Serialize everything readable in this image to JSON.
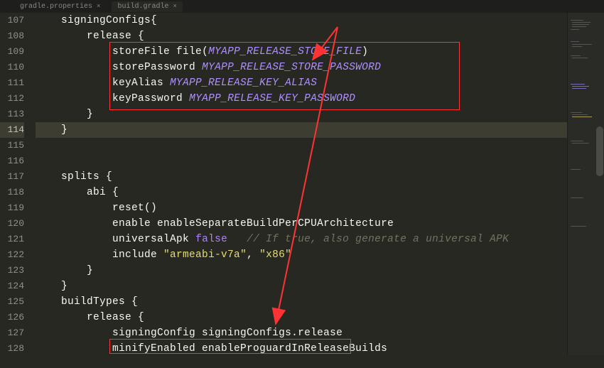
{
  "tabs": [
    {
      "label": "gradle.properties",
      "active": false
    },
    {
      "label": "build.gradle",
      "active": true
    }
  ],
  "lineNumbers": [
    "107",
    "108",
    "109",
    "110",
    "111",
    "112",
    "113",
    "114",
    "115",
    "116",
    "117",
    "118",
    "119",
    "120",
    "121",
    "122",
    "123",
    "124",
    "125",
    "126",
    "127",
    "128"
  ],
  "currentLine": "114",
  "code": {
    "l107": {
      "indent": "    ",
      "text": "signingConfigs{"
    },
    "l108": {
      "indent": "        ",
      "text": "release {"
    },
    "l109": {
      "indent": "            ",
      "a": "storeFile ",
      "b": "file",
      "c": "(",
      "d": "MYAPP_RELEASE_STORE_FILE",
      "e": ")"
    },
    "l110": {
      "indent": "            ",
      "a": "storePassword ",
      "d": "MYAPP_RELEASE_STORE_PASSWORD"
    },
    "l111": {
      "indent": "            ",
      "a": "keyAlias ",
      "d": "MYAPP_RELEASE_KEY_ALIAS"
    },
    "l112": {
      "indent": "            ",
      "a": "keyPassword ",
      "d": "MYAPP_RELEASE_KEY_PASSWORD"
    },
    "l113": {
      "indent": "        ",
      "text": "}"
    },
    "l114": {
      "indent": "    ",
      "text": "}"
    },
    "l115": {
      "text": ""
    },
    "l116": {
      "text": ""
    },
    "l117": {
      "indent": "    ",
      "text": "splits {"
    },
    "l118": {
      "indent": "        ",
      "text": "abi {"
    },
    "l119": {
      "indent": "            ",
      "a": "reset",
      "b": "()"
    },
    "l120": {
      "indent": "            ",
      "a": "enable enableSeparateBuildPerCPUArchitecture"
    },
    "l121": {
      "indent": "            ",
      "a": "universalApk ",
      "b": "false",
      "c": "   // If true, also generate a universal APK"
    },
    "l122": {
      "indent": "            ",
      "a": "include ",
      "b": "\"armeabi-v7a\"",
      "c": ", ",
      "d": "\"x86\""
    },
    "l123": {
      "indent": "        ",
      "text": "}"
    },
    "l124": {
      "indent": "    ",
      "text": "}"
    },
    "l125": {
      "indent": "    ",
      "text": "buildTypes {"
    },
    "l126": {
      "indent": "        ",
      "text": "release {"
    },
    "l127": {
      "indent": "            ",
      "a": "signingConfig signingConfigs",
      "b": ".",
      "c": "release"
    },
    "l128": {
      "indent": "            ",
      "a": "minifyEnabled enableProguardInReleaseBuilds"
    }
  },
  "colors": {
    "accent": "#ff3333",
    "identifier": "#b08fff"
  }
}
